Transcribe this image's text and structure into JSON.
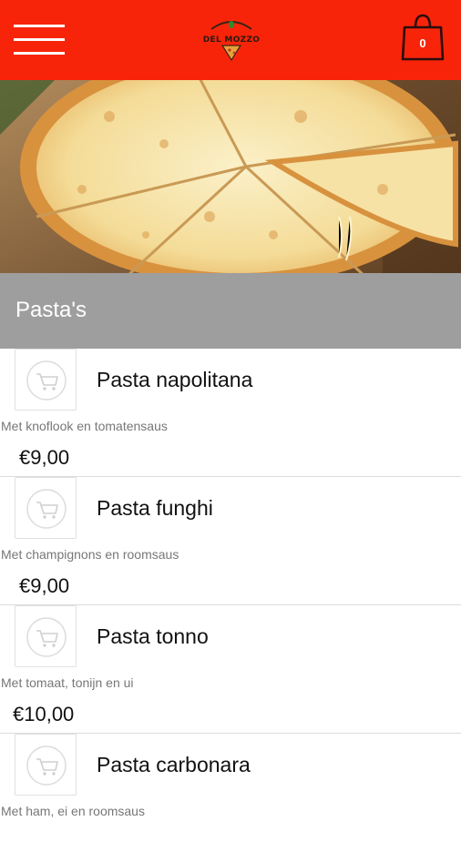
{
  "header": {
    "menu_icon": "hamburger-menu-icon",
    "logo_text": "DEL MOZZO",
    "cart_icon": "shopping-bag-icon",
    "cart_count": "0",
    "accent_color": "#f8240a"
  },
  "hero": {
    "image": "cheese pizza photo"
  },
  "section": {
    "title": "Pasta's"
  },
  "items": [
    {
      "name": "Pasta napolitana",
      "description": "Met knoflook en tomatensaus",
      "price": "€9,00"
    },
    {
      "name": "Pasta funghi",
      "description": "Met champignons en roomsaus",
      "price": "€9,00"
    },
    {
      "name": "Pasta tonno",
      "description": "Met tomaat, tonijn en ui",
      "price": "€10,00"
    },
    {
      "name": "Pasta carbonara",
      "description": "Met ham, ei en roomsaus",
      "price": ""
    }
  ]
}
